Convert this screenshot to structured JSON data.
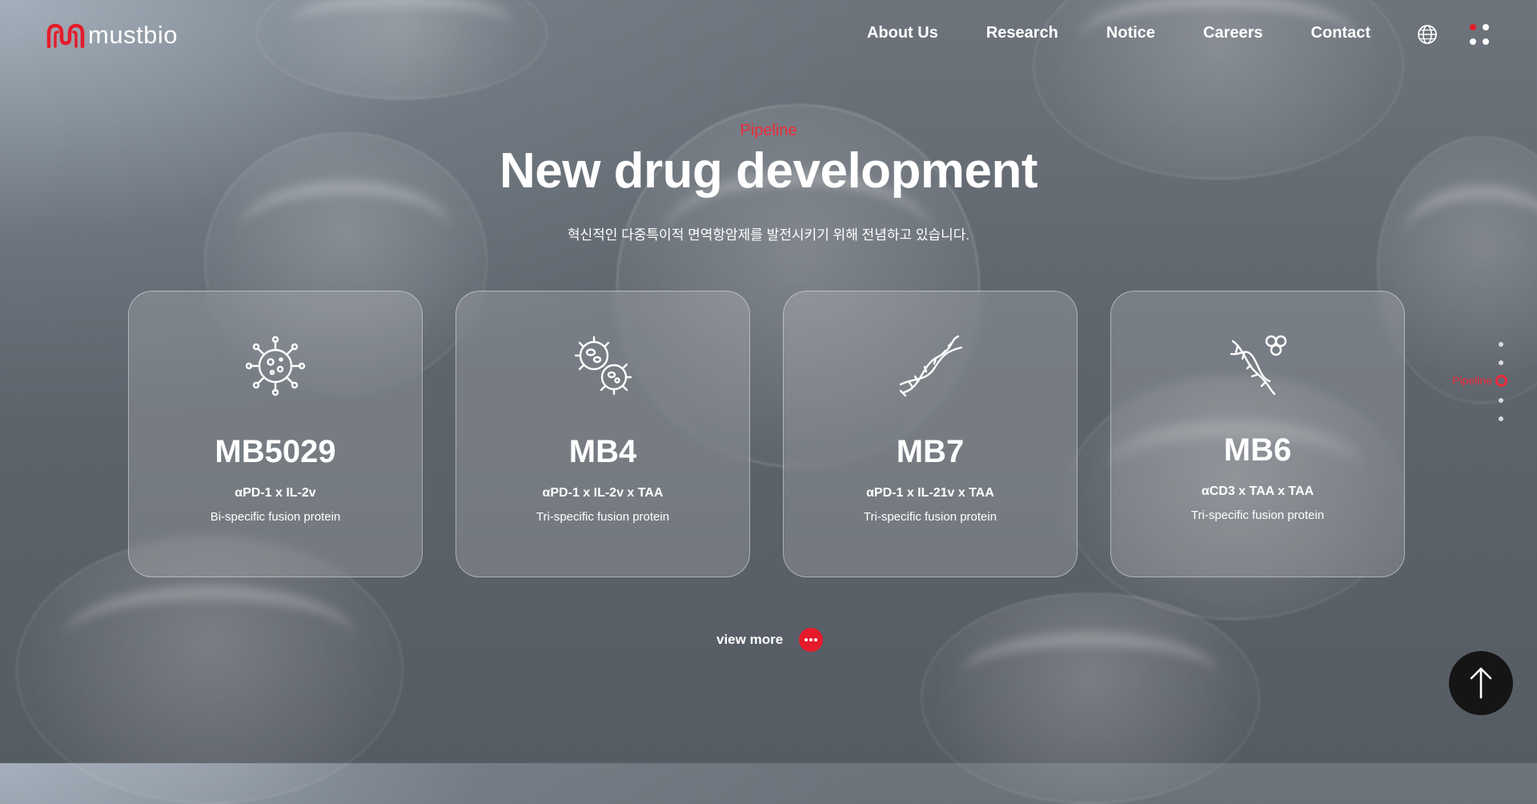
{
  "brand": {
    "name": "mustbio",
    "accent_color": "#e51b2b"
  },
  "nav": {
    "items": [
      {
        "label": "About Us"
      },
      {
        "label": "Research"
      },
      {
        "label": "Notice"
      },
      {
        "label": "Careers"
      },
      {
        "label": "Contact"
      }
    ],
    "language_icon": "globe-icon",
    "menu_icon": "menu-dots-icon"
  },
  "hero": {
    "eyebrow": "Pipeline",
    "title": "New drug development",
    "subtitle": "혁신적인 다중특이적 면역항암제를 발전시키기 위해 전념하고 있습니다."
  },
  "cards": [
    {
      "icon": "virus-icon",
      "title": "MB5029",
      "formula": "αPD-1 x IL-2v",
      "description": "Bi-specific fusion protein"
    },
    {
      "icon": "bacteria-icon",
      "title": "MB4",
      "formula": "αPD-1 x IL-2v x TAA",
      "description": "Tri-specific fusion protein"
    },
    {
      "icon": "dna-icon",
      "title": "MB7",
      "formula": "αPD-1 x IL-21v x TAA",
      "description": "Tri-specific fusion protein"
    },
    {
      "icon": "dna-molecule-icon",
      "title": "MB6",
      "formula": "αCD3 x TAA x TAA",
      "description": "Tri-specific fusion protein"
    }
  ],
  "view_more": {
    "label": "view more"
  },
  "side_pagination": {
    "active_label": "Pipeline",
    "total": 5,
    "active_index": 3
  },
  "scroll_top_icon": "arrow-up-icon"
}
